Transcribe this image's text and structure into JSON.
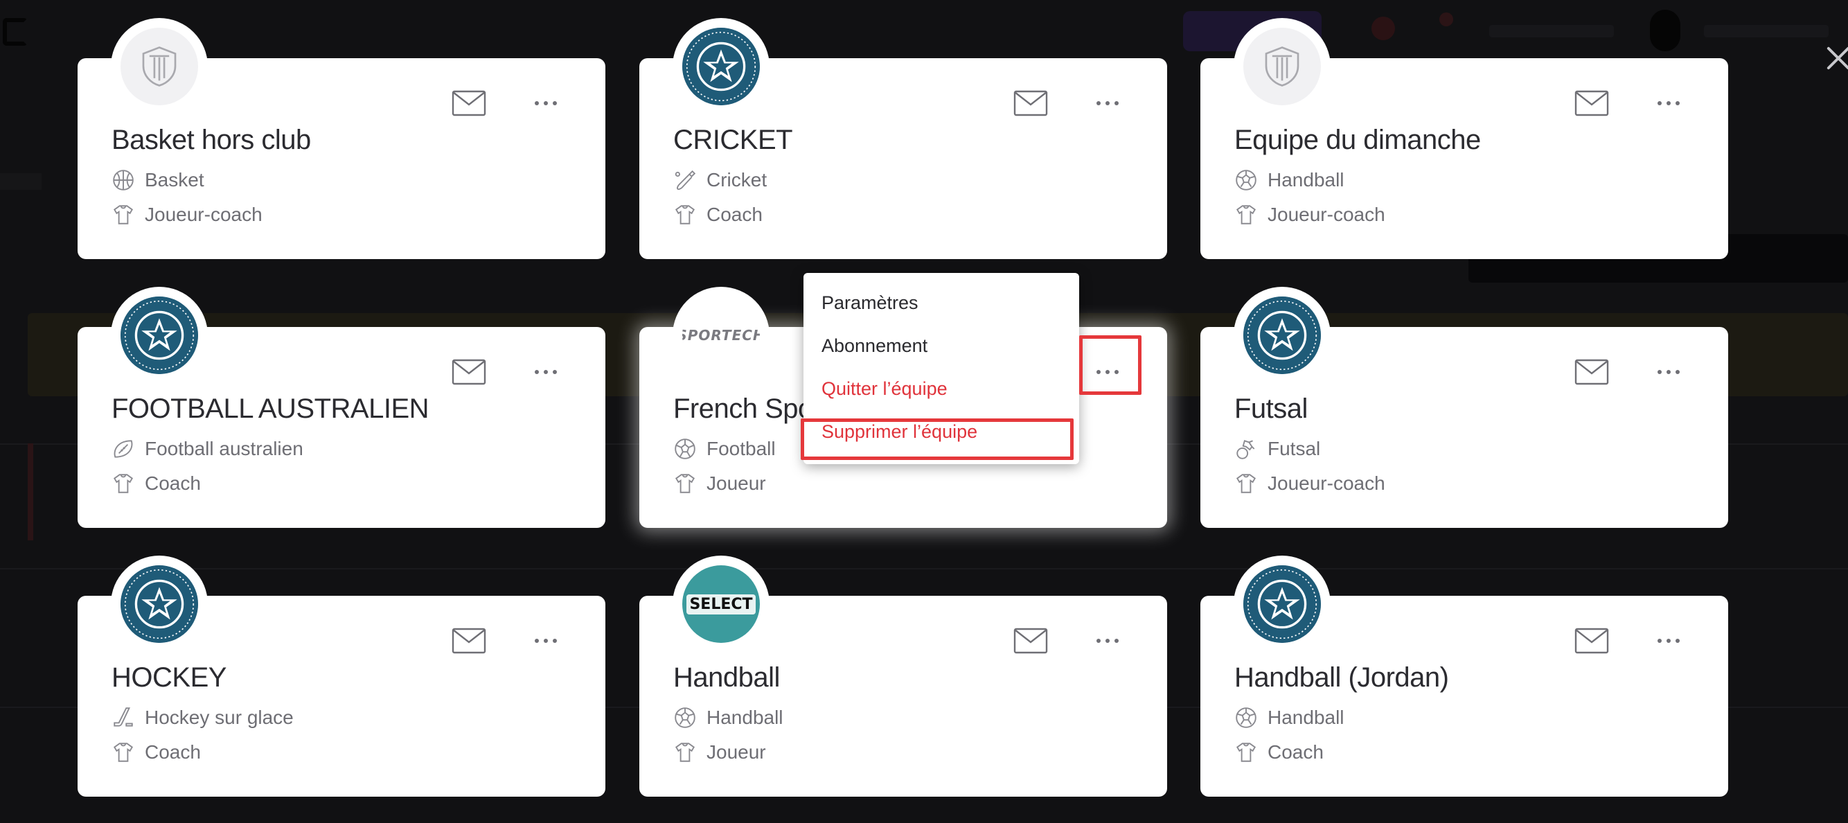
{
  "close_label": "×",
  "teams": [
    {
      "name": "Basket hors club",
      "sport": "Basket",
      "role": "Joueur-coach",
      "logo": "default-shield",
      "sport_icon": "basketball-icon"
    },
    {
      "name": "CRICKET",
      "sport": "Cricket",
      "role": "Coach",
      "logo": "olympiens",
      "sport_icon": "cricket-bat-icon"
    },
    {
      "name": "Equipe du dimanche",
      "sport": "Handball",
      "role": "Joueur-coach",
      "logo": "default-shield",
      "sport_icon": "handball-icon"
    },
    {
      "name": "FOOTBALL AUSTRALIEN",
      "sport": "Football australien",
      "role": "Coach",
      "logo": "olympiens",
      "sport_icon": "rugby-ball-icon"
    },
    {
      "name": "French Sportech",
      "name_visible": "French Spo",
      "sport": "Football",
      "role": "Joueur",
      "logo": "sportech",
      "sport_icon": "soccer-ball-icon"
    },
    {
      "name": "Futsal",
      "sport": "Futsal",
      "role": "Joueur-coach",
      "logo": "olympiens",
      "sport_icon": "futsal-icon"
    },
    {
      "name": "HOCKEY",
      "sport": "Hockey sur glace",
      "role": "Coach",
      "logo": "olympiens",
      "sport_icon": "hockey-stick-icon"
    },
    {
      "name": "Handball",
      "sport": "Handball",
      "role": "Joueur",
      "logo": "select-ball",
      "sport_icon": "handball-icon"
    },
    {
      "name": "Handball (Jordan)",
      "sport": "Handball",
      "role": "Coach",
      "logo": "olympiens",
      "sport_icon": "handball-icon"
    }
  ],
  "logo_texts": {
    "sportech": "SPORTECH",
    "select": "SELECT"
  },
  "menu": {
    "items": [
      {
        "label": "Paramètres",
        "danger": false
      },
      {
        "label": "Abonnement",
        "danger": false
      },
      {
        "label": "Quitter l’équipe",
        "danger": true
      },
      {
        "label": "Supprimer l’équipe",
        "danger": true
      }
    ]
  },
  "colors": {
    "danger": "#e0333b",
    "highlight": "#e5383b",
    "team_logo": "#1f5b78",
    "text": "#2b2b30",
    "muted": "#6e6e74"
  }
}
